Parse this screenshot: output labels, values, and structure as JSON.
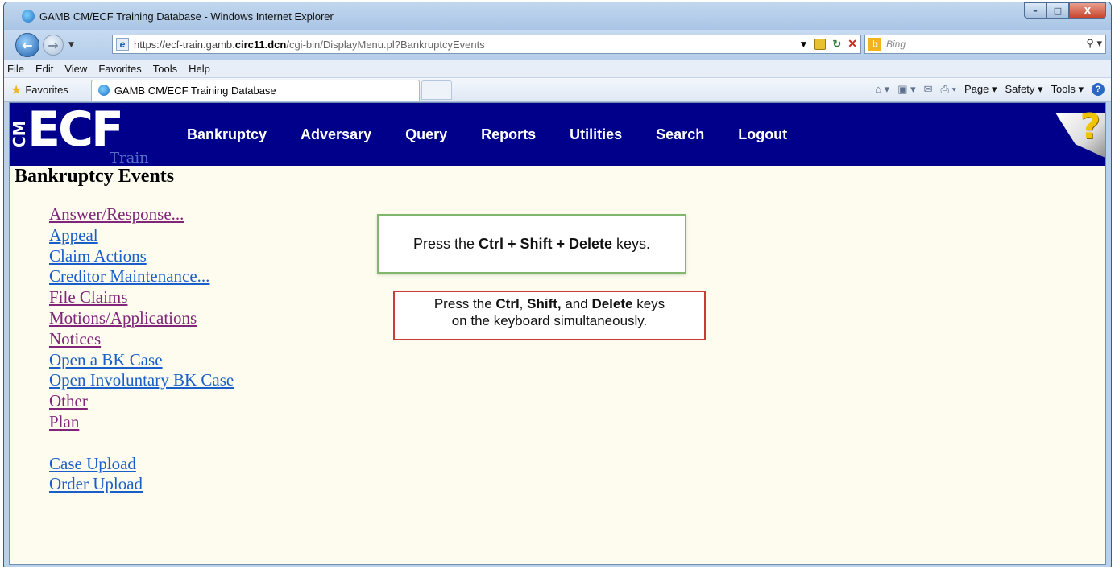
{
  "window": {
    "title": "GAMB CM/ECF Training Database - Windows Internet Explorer",
    "min_glyph": "–",
    "max_glyph": "□",
    "close_glyph": "X"
  },
  "address": {
    "scheme": "https://",
    "host_pre": "ecf-train.gamb.",
    "host_bold": "circ11.dcn",
    "path": "/cgi-bin/DisplayMenu.pl?BankruptcyEvents"
  },
  "search": {
    "engine_letter": "b",
    "placeholder": "Bing"
  },
  "menubar": [
    "File",
    "Edit",
    "View",
    "Favorites",
    "Tools",
    "Help"
  ],
  "favbar": {
    "favorites_label": "Favorites",
    "tab_title": "GAMB CM/ECF Training Database",
    "page_menu": "Page ▾",
    "safety_menu": "Safety ▾",
    "tools_menu": "Tools ▾"
  },
  "ecf": {
    "logo_cm": "CM",
    "logo_ecf": "ECF",
    "logo_train": "Train",
    "nav": [
      "Bankruptcy",
      "Adversary",
      "Query",
      "Reports",
      "Utilities",
      "Search",
      "Logout"
    ],
    "help_glyph": "?"
  },
  "page": {
    "heading": "Bankruptcy Events",
    "events_group1": [
      {
        "label": "Answer/Response...",
        "visited": true
      },
      {
        "label": "Appeal",
        "visited": false
      },
      {
        "label": "Claim Actions",
        "visited": false
      },
      {
        "label": "Creditor Maintenance...",
        "visited": false
      },
      {
        "label": "File Claims",
        "visited": true
      },
      {
        "label": "Motions/Applications",
        "visited": true
      },
      {
        "label": "Notices",
        "visited": true
      },
      {
        "label": "Open a BK Case",
        "visited": false
      },
      {
        "label": "Open Involuntary BK Case",
        "visited": false
      },
      {
        "label": "Other",
        "visited": true
      },
      {
        "label": "Plan",
        "visited": true
      }
    ],
    "events_group2": [
      {
        "label": "Case Upload",
        "visited": false
      },
      {
        "label": "Order Upload",
        "visited": false
      }
    ]
  },
  "callouts": {
    "green": {
      "pre": "Press the ",
      "keys": "Ctrl + Shift + Delete",
      "post": " keys."
    },
    "red": {
      "pre": "Press the ",
      "key1": "Ctrl",
      "sep1": ", ",
      "key2": "Shift,",
      "sep2": " and ",
      "key3": "Delete",
      "post": " keys",
      "line2": "on the keyboard simultaneously."
    }
  },
  "colors": {
    "ecf_nav_bg": "#00008b",
    "page_bg": "#fdfcee",
    "link_visited": "#80257a",
    "link_unvisited": "#1a5fc9",
    "callout_green_border": "#7fb86a",
    "callout_red_border": "#cc3a3a"
  }
}
